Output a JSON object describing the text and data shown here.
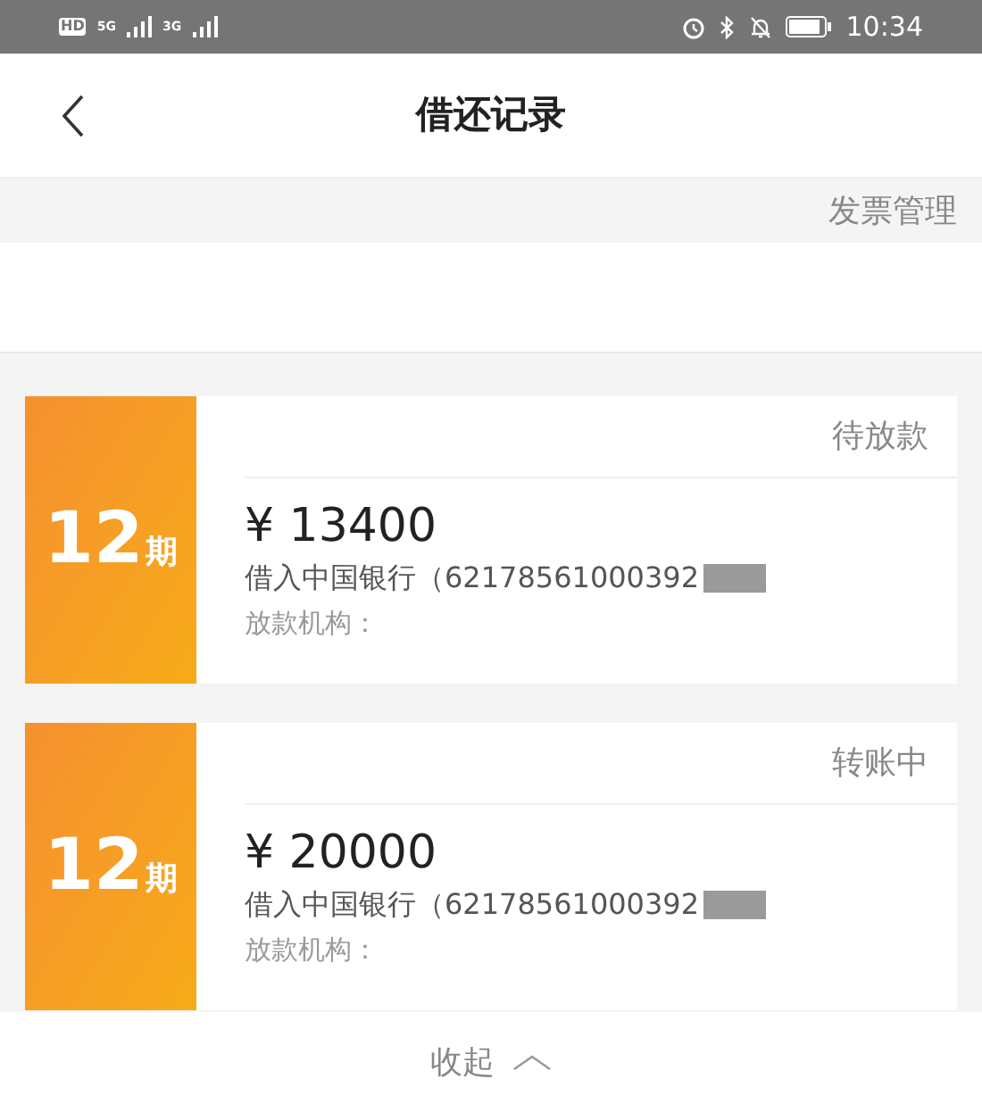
{
  "status_bar": {
    "network_labels": [
      "HD",
      "5G",
      "3G"
    ],
    "time": "10:34"
  },
  "header": {
    "title": "借还记录"
  },
  "invoice_link": "发票管理",
  "records": [
    {
      "term": "12",
      "term_unit": "期",
      "status": "待放款",
      "amount": "¥ 13400",
      "account": "借入中国银行（62178561000392",
      "lender_label": "放款机构："
    },
    {
      "term": "12",
      "term_unit": "期",
      "status": "转账中",
      "amount": "¥ 20000",
      "account": "借入中国银行（62178561000392",
      "lender_label": "放款机构："
    }
  ],
  "collapse": {
    "label": "收起"
  }
}
